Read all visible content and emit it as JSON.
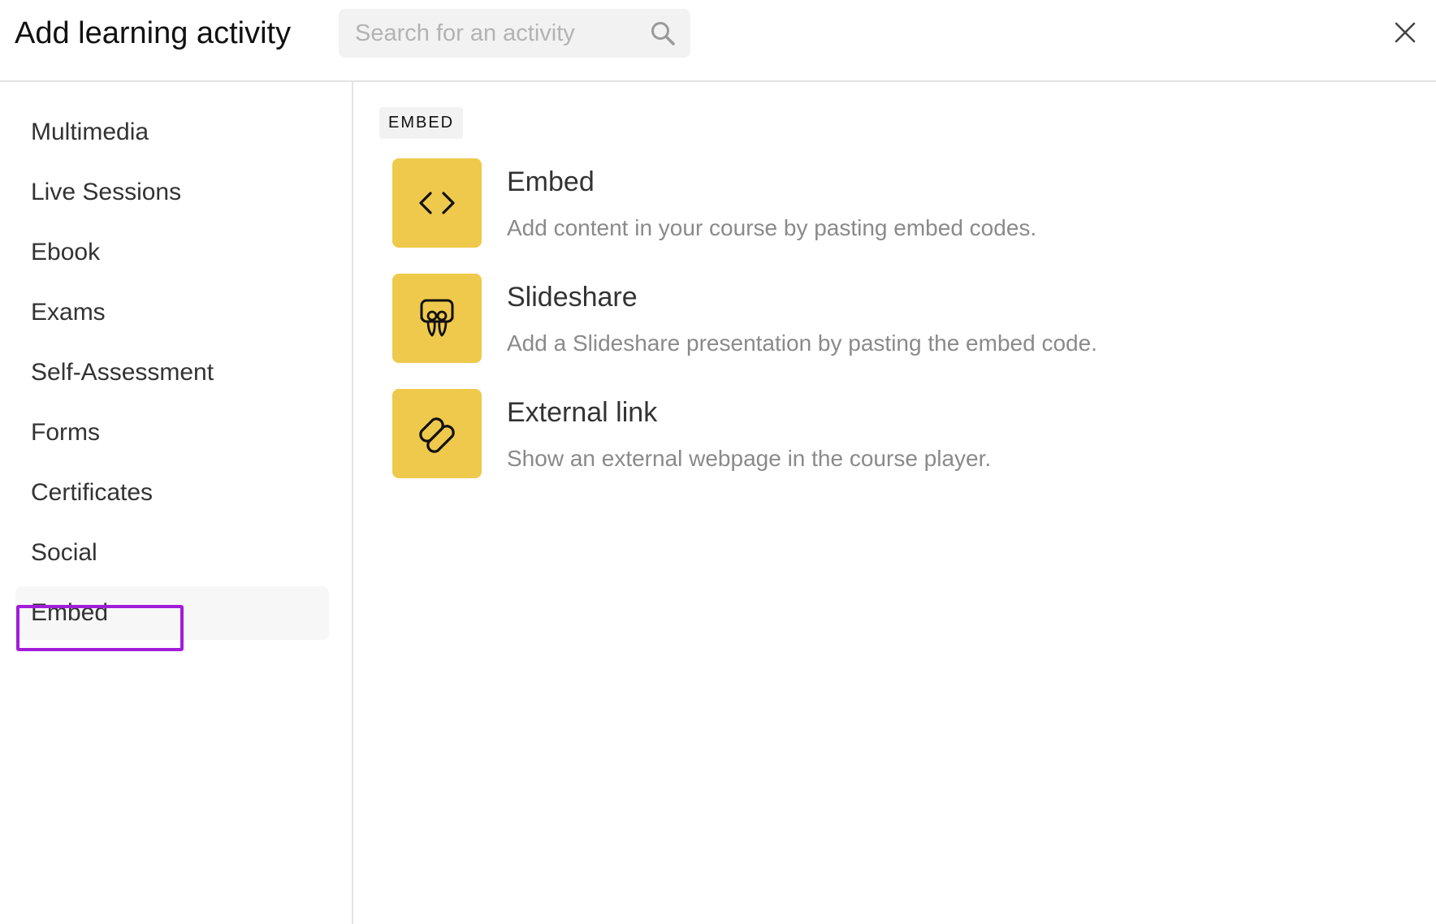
{
  "header": {
    "title": "Add learning activity",
    "search_placeholder": "Search for an activity",
    "search_value": ""
  },
  "sidebar": {
    "items": [
      {
        "label": "Multimedia"
      },
      {
        "label": "Live Sessions"
      },
      {
        "label": "Ebook"
      },
      {
        "label": "Exams"
      },
      {
        "label": "Self-Assessment"
      },
      {
        "label": "Forms"
      },
      {
        "label": "Certificates"
      },
      {
        "label": "Social"
      },
      {
        "label": "Embed",
        "active": true
      }
    ]
  },
  "main": {
    "section_label": "EMBED",
    "activities": [
      {
        "name": "Embed",
        "description": "Add content in your course by pasting embed codes.",
        "icon": "code-icon"
      },
      {
        "name": "Slideshare",
        "description": "Add a Slideshare presentation by pasting the embed code.",
        "icon": "slideshare-icon"
      },
      {
        "name": "External link",
        "description": "Show an external webpage in the course player.",
        "icon": "link-icon"
      }
    ]
  },
  "colors": {
    "tile_background": "#efc94c",
    "highlight": "#a21cd9",
    "active_item_background": "#f7f7f7"
  }
}
